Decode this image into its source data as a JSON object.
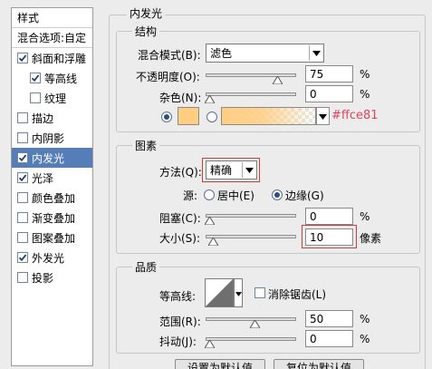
{
  "sidebar": {
    "header": "样式",
    "blend_options": "混合选项:自定",
    "items": [
      {
        "label": "斜面和浮雕",
        "checked": true
      },
      {
        "label": "等高线",
        "checked": true
      },
      {
        "label": "纹理",
        "checked": false
      },
      {
        "label": "描边",
        "checked": false
      },
      {
        "label": "内阴影",
        "checked": false
      },
      {
        "label": "内发光",
        "checked": true
      },
      {
        "label": "光泽",
        "checked": true
      },
      {
        "label": "颜色叠加",
        "checked": false
      },
      {
        "label": "渐变叠加",
        "checked": false
      },
      {
        "label": "图案叠加",
        "checked": false
      },
      {
        "label": "外发光",
        "checked": true
      },
      {
        "label": "投影",
        "checked": false
      }
    ]
  },
  "panel": {
    "title": "内发光",
    "structure": {
      "title": "结构",
      "blend_mode_label": "混合模式(B):",
      "blend_mode_value": "滤色",
      "opacity_label": "不透明度(O):",
      "opacity_value": "75",
      "opacity_level": 0.75,
      "noise_label": "杂色(N):",
      "noise_value": "0",
      "noise_level": 0,
      "percent": "%",
      "glow_color": "#ffce81",
      "glow_color_label": "#ffce81"
    },
    "elements": {
      "title": "图素",
      "method_label": "方法(Q):",
      "method_value": "精确",
      "source_label": "源:",
      "source_center": "居中(E)",
      "source_edge": "边缘(G)",
      "choke_label": "阻塞(C):",
      "choke_value": "0",
      "choke_level": 0,
      "size_label": "大小(S):",
      "size_value": "10",
      "size_level": 0.04,
      "size_unit": "像素",
      "percent": "%"
    },
    "quality": {
      "title": "品质",
      "contour_label": "等高线:",
      "antialias_label": "消除锯齿(L)",
      "range_label": "范围(R):",
      "range_value": "50",
      "range_level": 0.5,
      "jitter_label": "抖动(J):",
      "jitter_value": "0",
      "jitter_level": 0,
      "percent": "%"
    },
    "buttons": {
      "set_default": "设置为默认值",
      "reset_default": "复位为默认值"
    }
  },
  "colors": {
    "accent_selected": "#557eb9",
    "highlight_red": "#d23a3a",
    "glow": "#ffce81"
  }
}
